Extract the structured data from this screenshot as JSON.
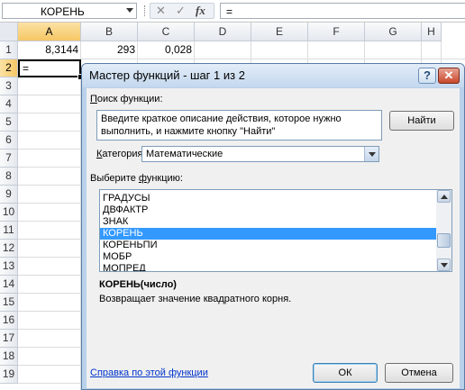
{
  "formula_bar": {
    "name_box": "КОРЕНЬ",
    "cancel_glyph": "✕",
    "enter_glyph": "✓",
    "fx_glyph": "fx",
    "content": "="
  },
  "sheet": {
    "columns": [
      "A",
      "B",
      "C",
      "D",
      "E",
      "F",
      "G",
      "H"
    ],
    "rows": [
      "1",
      "2",
      "3",
      "4",
      "5",
      "6",
      "7",
      "8",
      "9",
      "10",
      "11",
      "12",
      "13",
      "14",
      "15",
      "16",
      "17",
      "18",
      "19"
    ],
    "cells": {
      "A1": "8,3144",
      "B1": "293",
      "C1": "0,028",
      "A2": "="
    }
  },
  "dialog": {
    "title": "Мастер функций - шаг 1 из 2",
    "help_button": "?",
    "close_button": "✕",
    "search_label_underlined": "П",
    "search_label_rest": "оиск функции:",
    "search_text": "Введите краткое описание действия, которое нужно выполнить, и нажмите кнопку \"Найти\"",
    "find_button": "Найти",
    "category_label_underlined": "К",
    "category_label_rest": "атегория:",
    "category_value": "Математические",
    "select_label_pre": "Выберите ",
    "select_label_underlined": "ф",
    "select_label_rest": "ункцию:",
    "functions": [
      "ГРАДУСЫ",
      "ДВФАКТР",
      "ЗНАК",
      "КОРЕНЬ",
      "КОРЕНЬПИ",
      "МОБР",
      "МОПРЕД"
    ],
    "selected_function": "КОРЕНЬ",
    "signature": "КОРЕНЬ(число)",
    "description": "Возвращает значение квадратного корня.",
    "help_link": "Справка по этой функции",
    "ok_button": "ОК",
    "cancel_button": "Отмена"
  }
}
